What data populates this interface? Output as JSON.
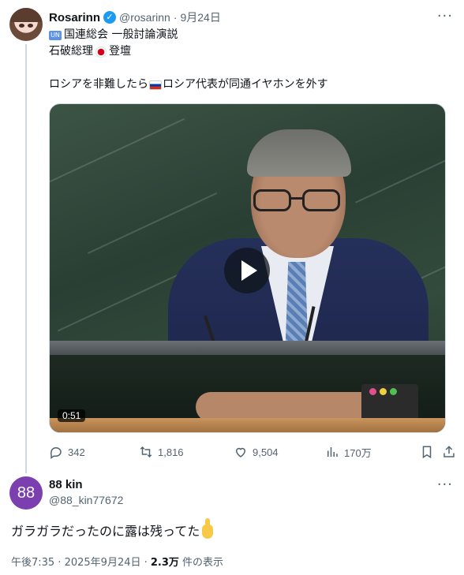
{
  "parent_tweet": {
    "author_name": "Rosarinn",
    "handle": "@rosarinn",
    "separator": "·",
    "date": "9月24日",
    "verified_icon": "verified-badge-icon",
    "more_icon": "more-options-icon",
    "lines": {
      "line1": "国連総会 一般討論演説",
      "line2a": "石破総理",
      "line2b": "登壇",
      "line3a": "ロシアを非難したら",
      "line3b": "ロシア代表が同通イヤホンを外す"
    },
    "flags": {
      "un": "un-flag-icon",
      "japan": "japan-flag-icon",
      "russia": "russia-flag-icon"
    },
    "video": {
      "duration": "0:51",
      "play_icon": "play-icon"
    },
    "actions": {
      "replies": "342",
      "retweets": "1,816",
      "likes": "9,504",
      "views": "170万"
    }
  },
  "reply_tweet": {
    "avatar_text": "88",
    "avatar_color": "#7b3fb0",
    "author_name": "88 kin",
    "handle": "@88_kin77672",
    "text": "ガラガラだったのに露は残ってた",
    "emoji": "middle-finger-emoji",
    "time": "午後7:35 · 2025年9月24日 · ",
    "views_count": "2.3万",
    "views_label": " 件の表示"
  },
  "colors": {
    "accent": "#1d9bf0",
    "secondary_text": "#536471",
    "primary_text": "#0f1419"
  }
}
